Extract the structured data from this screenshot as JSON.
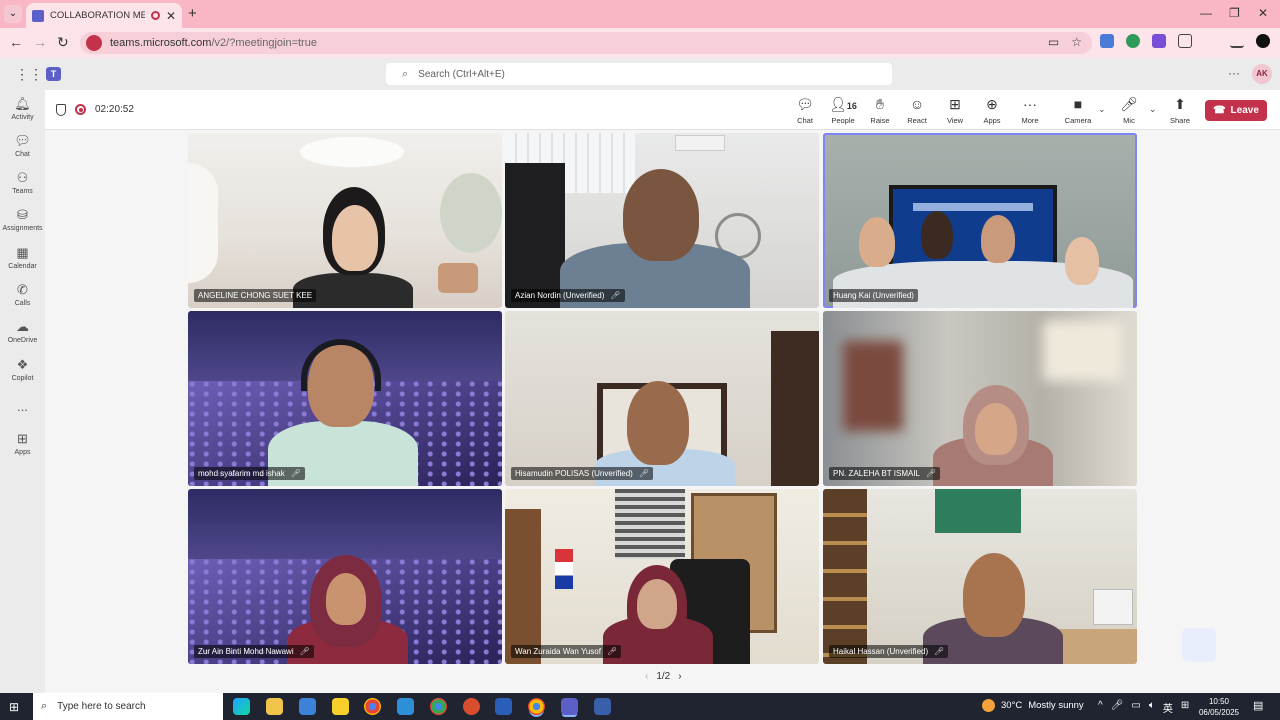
{
  "browser": {
    "tab_title": "COLLABORATION MEETING",
    "url_host": "teams.microsoft.com",
    "url_path": "/v2/?meetingjoin=true"
  },
  "teams": {
    "search_placeholder": "Search (Ctrl+Alt+E)",
    "user_initials": "AK",
    "rail": [
      {
        "label": "Activity",
        "icon": "bell-icon"
      },
      {
        "label": "Chat",
        "icon": "chat-icon"
      },
      {
        "label": "Teams",
        "icon": "teams-icon"
      },
      {
        "label": "Assignments",
        "icon": "assignments-icon"
      },
      {
        "label": "Calendar",
        "icon": "calendar-icon"
      },
      {
        "label": "Calls",
        "icon": "phone-icon"
      },
      {
        "label": "OneDrive",
        "icon": "cloud-icon"
      },
      {
        "label": "Copilot",
        "icon": "copilot-icon"
      },
      {
        "label": "...",
        "icon": "more-icon"
      },
      {
        "label": "Apps",
        "icon": "plus-icon"
      }
    ]
  },
  "meeting": {
    "timer": "02:20:52",
    "people_count": "16",
    "toolbar": {
      "chat": "Chat",
      "people": "People",
      "raise": "Raise",
      "react": "React",
      "view": "View",
      "apps": "Apps",
      "more": "More",
      "camera": "Camera",
      "mic": "Mic",
      "share": "Share",
      "leave": "Leave"
    },
    "participants": [
      {
        "name": "ANGELINE CHONG SUET KEE",
        "muted": false
      },
      {
        "name": "Azian Nordin (Unverified)",
        "muted": true
      },
      {
        "name": "Huang Kai (Unverified)",
        "muted": false
      },
      {
        "name": "mohd syafarim md ishak",
        "muted": true
      },
      {
        "name": "Hisamudin POLISAS (Unverified)",
        "muted": true
      },
      {
        "name": "PN. ZALEHA BT ISMAIL",
        "muted": true
      },
      {
        "name": "Zur Ain Binti Mohd Nawawi",
        "muted": true
      },
      {
        "name": "Wan Zuraida Wan Yusof",
        "muted": true
      },
      {
        "name": "Haikal Hassan (Unverified)",
        "muted": true
      }
    ],
    "page": "1/2"
  },
  "taskbar": {
    "search_placeholder": "Type here to search",
    "temperature": "30°C",
    "weather": "Mostly sunny",
    "ime": "英",
    "time": "10:50",
    "date": "06/05/2025"
  }
}
